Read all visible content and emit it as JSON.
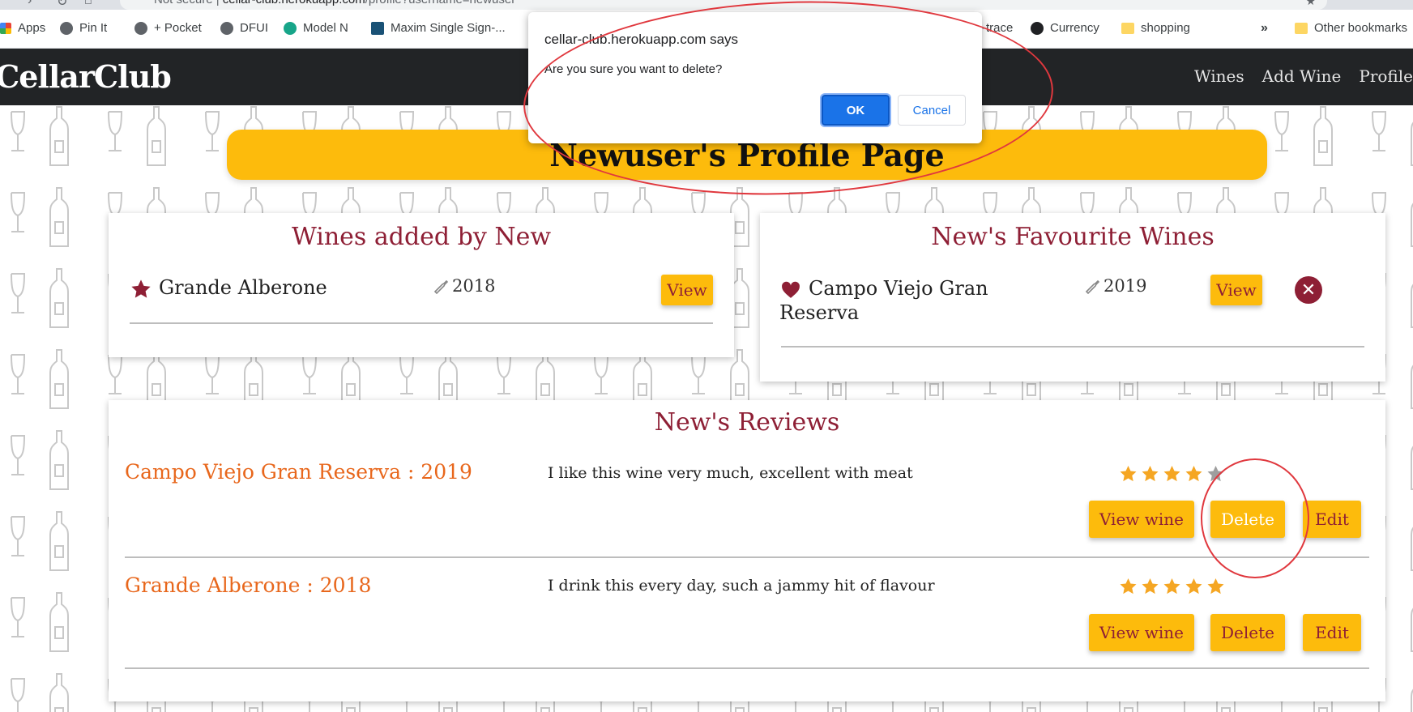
{
  "browser": {
    "url_security": "Not secure",
    "url_host": "cellar-club.herokuapp.com",
    "url_path": "/profile?username=newuser",
    "bookmarks": [
      {
        "label": "Apps",
        "icon": "apps-icon"
      },
      {
        "label": "Pin It",
        "icon": "globe-icon"
      },
      {
        "label": "+ Pocket",
        "icon": "globe-icon"
      },
      {
        "label": "DFUI",
        "icon": "globe-icon"
      },
      {
        "label": "Model N",
        "icon": "model-n-icon"
      },
      {
        "label": "Maxim Single Sign-...",
        "icon": "maxim-icon"
      },
      {
        "label": "-trace",
        "icon": ""
      },
      {
        "label": "Currency",
        "icon": "currency-icon"
      },
      {
        "label": "shopping",
        "icon": "folder-icon"
      }
    ],
    "more": "»",
    "other_bookmarks": "Other bookmarks"
  },
  "site": {
    "brand": "CellarClub",
    "nav": [
      "Wines",
      "Add Wine",
      "Profile"
    ]
  },
  "page": {
    "title": "Newuser's Profile Page"
  },
  "added": {
    "heading": "Wines added by New",
    "items": [
      {
        "name": "Grande Alberone",
        "year": "2018",
        "button": "View"
      }
    ]
  },
  "favourites": {
    "heading": "New's Favourite Wines",
    "items": [
      {
        "name_line1": "Campo Viejo Gran",
        "name_line2": "Reserva",
        "year": "2019",
        "button": "View"
      }
    ]
  },
  "reviews": {
    "heading": "New's Reviews",
    "items": [
      {
        "title": "Campo Viejo Gran Reserva : 2019",
        "text": "I like this wine very much, excellent with meat",
        "rating": 4,
        "max": 5,
        "buttons": [
          "View wine",
          "Delete",
          "Edit"
        ]
      },
      {
        "title": "Grande Alberone : 2018",
        "text": "I drink this every day, such a jammy hit of flavour",
        "rating": 5,
        "max": 5,
        "buttons": [
          "View wine",
          "Delete",
          "Edit"
        ]
      }
    ]
  },
  "dialog": {
    "title": "cellar-club.herokuapp.com says",
    "message": "Are you sure you want to delete?",
    "ok": "OK",
    "cancel": "Cancel"
  },
  "colors": {
    "accent_yellow": "#fdbb0c",
    "wine_red": "#8e1f35",
    "review_orange": "#e8671c",
    "star_filled": "#f5a623",
    "star_empty": "#9e9e9e",
    "annotation_red": "#e0383e"
  }
}
